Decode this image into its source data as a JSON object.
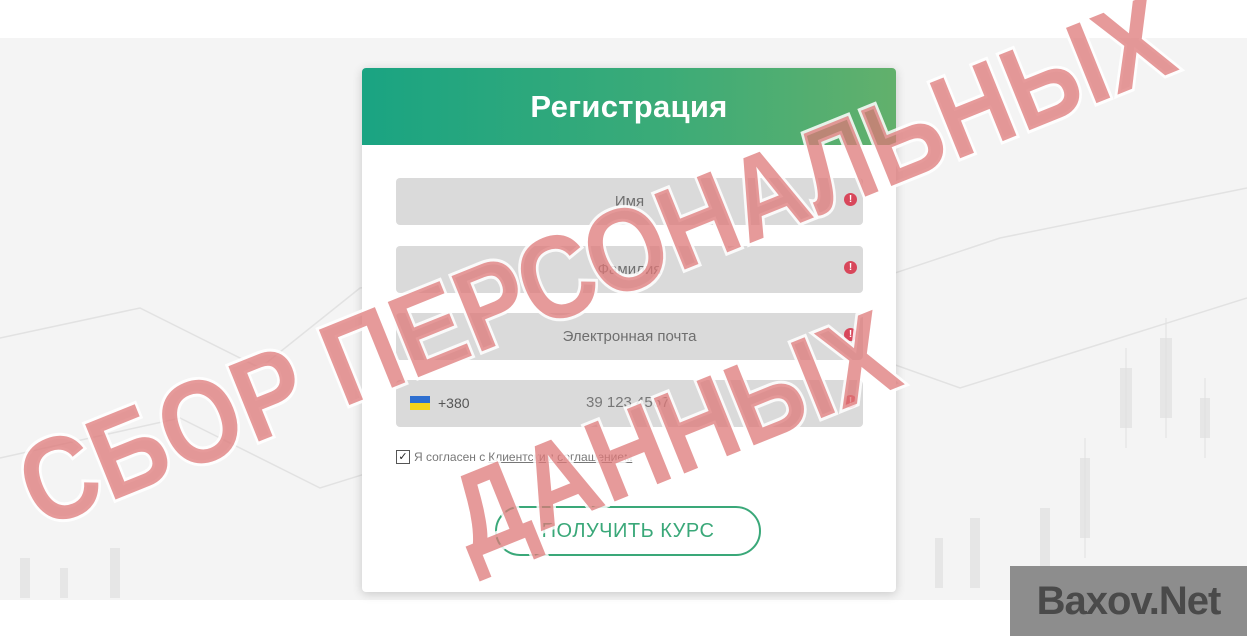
{
  "form": {
    "title": "Регистрация",
    "name_placeholder": "Имя",
    "surname_placeholder": "Фамилия",
    "email_placeholder": "Электронная почта",
    "phone_code": "+380",
    "phone_placeholder": "39 123 4567",
    "agree_text": "Я согласен с",
    "agree_link": "Клиентским соглашением",
    "checkbox_mark": "✓",
    "warn_mark": "!",
    "submit_label": "ПОЛУЧИТЬ КУРС"
  },
  "stamp": {
    "line1": "СБОР ПЕРСОНАЛЬНЫХ",
    "line2": "ДАННЫХ"
  },
  "watermark": "Baxov.Net",
  "colors": {
    "header_start": "#1aa482",
    "header_end": "#62b06c",
    "accent": "#3aa879",
    "warning": "#d8475b",
    "stamp": "#de7878"
  }
}
